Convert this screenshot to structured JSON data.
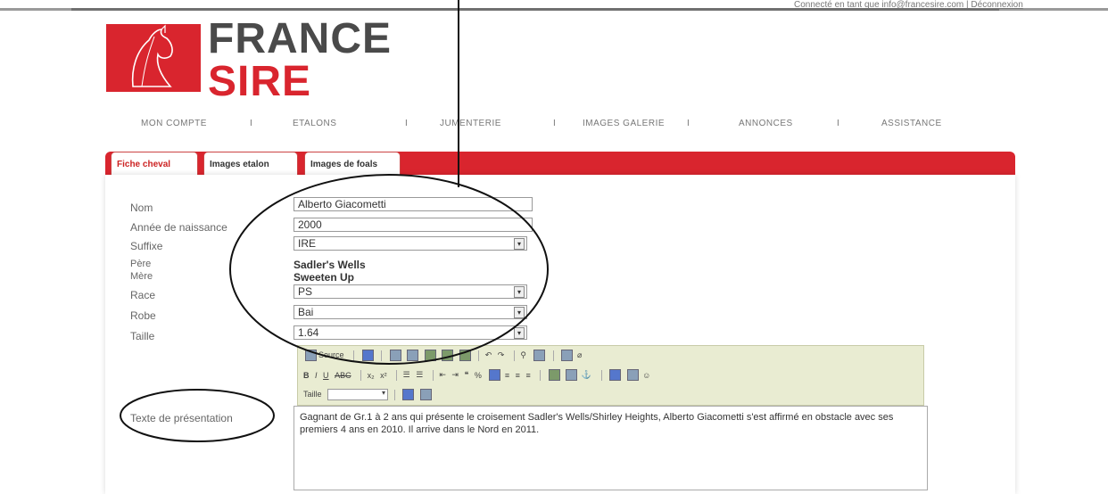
{
  "header": {
    "connected_text": "Connecté en tant que info@francesire.com |",
    "disconnect_label": "Déconnexion",
    "brand_line1": "FRANCE",
    "brand_line2": "SIRE"
  },
  "nav": {
    "items": [
      "MON COMPTE",
      "ETALONS",
      "JUMENTERIE",
      "IMAGES GALERIE",
      "ANNONCES",
      "ASSISTANCE"
    ],
    "separator": "I"
  },
  "tabs": [
    {
      "label": "Fiche cheval",
      "active": true
    },
    {
      "label": "Images etalon",
      "active": false
    },
    {
      "label": "Images de foals",
      "active": false
    }
  ],
  "form": {
    "nom": {
      "label": "Nom",
      "value": "Alberto Giacometti"
    },
    "annee": {
      "label": "Année de naissance",
      "value": "2000"
    },
    "suffixe": {
      "label": "Suffixe",
      "value": "IRE"
    },
    "pere": {
      "label": "Père",
      "value": "Sadler's Wells"
    },
    "mere": {
      "label": "Mère",
      "value": "Sweeten Up"
    },
    "race": {
      "label": "Race",
      "value": "PS"
    },
    "robe": {
      "label": "Robe",
      "value": "Bai"
    },
    "taille": {
      "label": "Taille",
      "value": "1.64"
    },
    "presentation": {
      "label": "Texte de présentation",
      "value": "Gagnant de Gr.1 à 2 ans qui présente le croisement Sadler's Wells/Shirley Heights, Alberto Giacometti s'est affirmé en obstacle avec ses premiers 4 ans en 2010. Il arrive dans le Nord en 2011."
    }
  },
  "editor": {
    "source_label": "Source",
    "size_label": "Taille"
  },
  "colors": {
    "brand_red": "#d9252e",
    "toolbar_bg": "#e9ecd2"
  }
}
